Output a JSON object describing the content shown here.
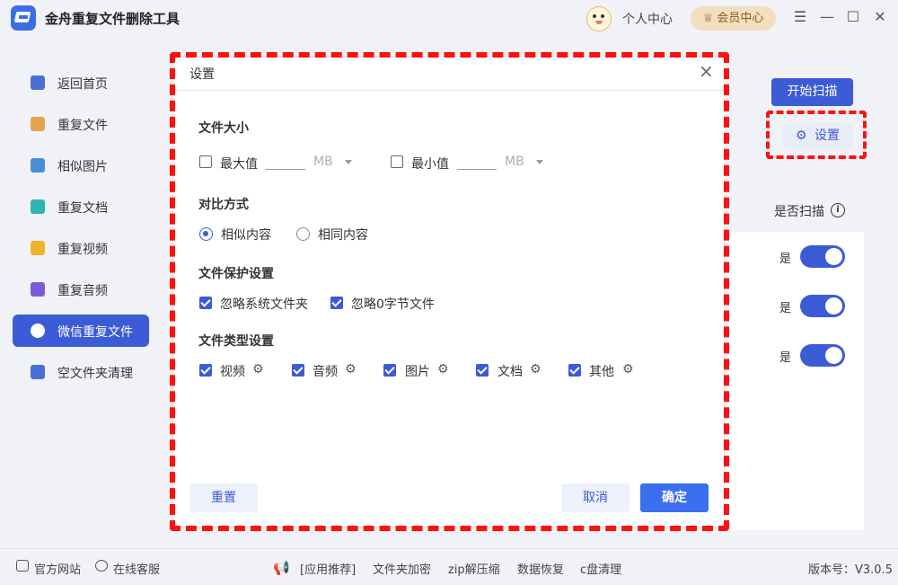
{
  "app": {
    "title": "金舟重复文件删除工具",
    "user_center": "个人中心",
    "vip": "♕ 会员中心",
    "win_menu": "☰",
    "win_min": "—",
    "win_max": "☐",
    "win_close": "✕"
  },
  "sidebar": {
    "items": [
      {
        "label": "返回首页",
        "icon": "home-icon",
        "color": "#4a6fd6"
      },
      {
        "label": "重复文件",
        "icon": "folder-icon",
        "color": "#e6a44a"
      },
      {
        "label": "相似图片",
        "icon": "image-icon",
        "color": "#4a8fd6"
      },
      {
        "label": "重复文档",
        "icon": "document-icon",
        "color": "#2fb3b3"
      },
      {
        "label": "重复视频",
        "icon": "video-icon",
        "color": "#f0b429"
      },
      {
        "label": "重复音频",
        "icon": "audio-icon",
        "color": "#7a5cd6"
      },
      {
        "label": "微信重复文件",
        "icon": "wechat-icon",
        "color": "#ffffff",
        "active": true
      },
      {
        "label": "空文件夹清理",
        "icon": "empty-folder-icon",
        "color": "#4a6fd6"
      }
    ]
  },
  "main": {
    "start_scan": "开始扫描",
    "settings": "设置",
    "scan_column": "是否扫描",
    "rows": [
      {
        "value": "是"
      },
      {
        "value": "是"
      },
      {
        "value": "是"
      }
    ]
  },
  "dialog": {
    "title": "设置",
    "file_size": {
      "heading": "文件大小",
      "max_label": "最大值",
      "max_unit": "MB",
      "max_checked": false,
      "min_label": "最小值",
      "min_unit": "MB",
      "min_checked": false
    },
    "compare": {
      "heading": "对比方式",
      "options": [
        {
          "label": "相似内容",
          "selected": true
        },
        {
          "label": "相同内容",
          "selected": false
        }
      ]
    },
    "protect": {
      "heading": "文件保护设置",
      "options": [
        {
          "label": "忽略系统文件夹",
          "checked": true
        },
        {
          "label": "忽略0字节文件",
          "checked": true
        }
      ]
    },
    "types": {
      "heading": "文件类型设置",
      "options": [
        {
          "label": "视频",
          "checked": true
        },
        {
          "label": "音频",
          "checked": true
        },
        {
          "label": "图片",
          "checked": true
        },
        {
          "label": "文档",
          "checked": true
        },
        {
          "label": "其他",
          "checked": true
        }
      ]
    },
    "reset": "重置",
    "cancel": "取消",
    "ok": "确定"
  },
  "footer": {
    "website": "官方网站",
    "service": "在线客服",
    "recommend": "[应用推荐]",
    "links": [
      "文件夹加密",
      "zip解压缩",
      "数据恢复",
      "c盘清理"
    ],
    "version": "版本号：V3.0.5"
  },
  "colors": {
    "accent": "#3c5bd6",
    "highlight": "#ff1010",
    "vip": "#f3dfc0"
  }
}
